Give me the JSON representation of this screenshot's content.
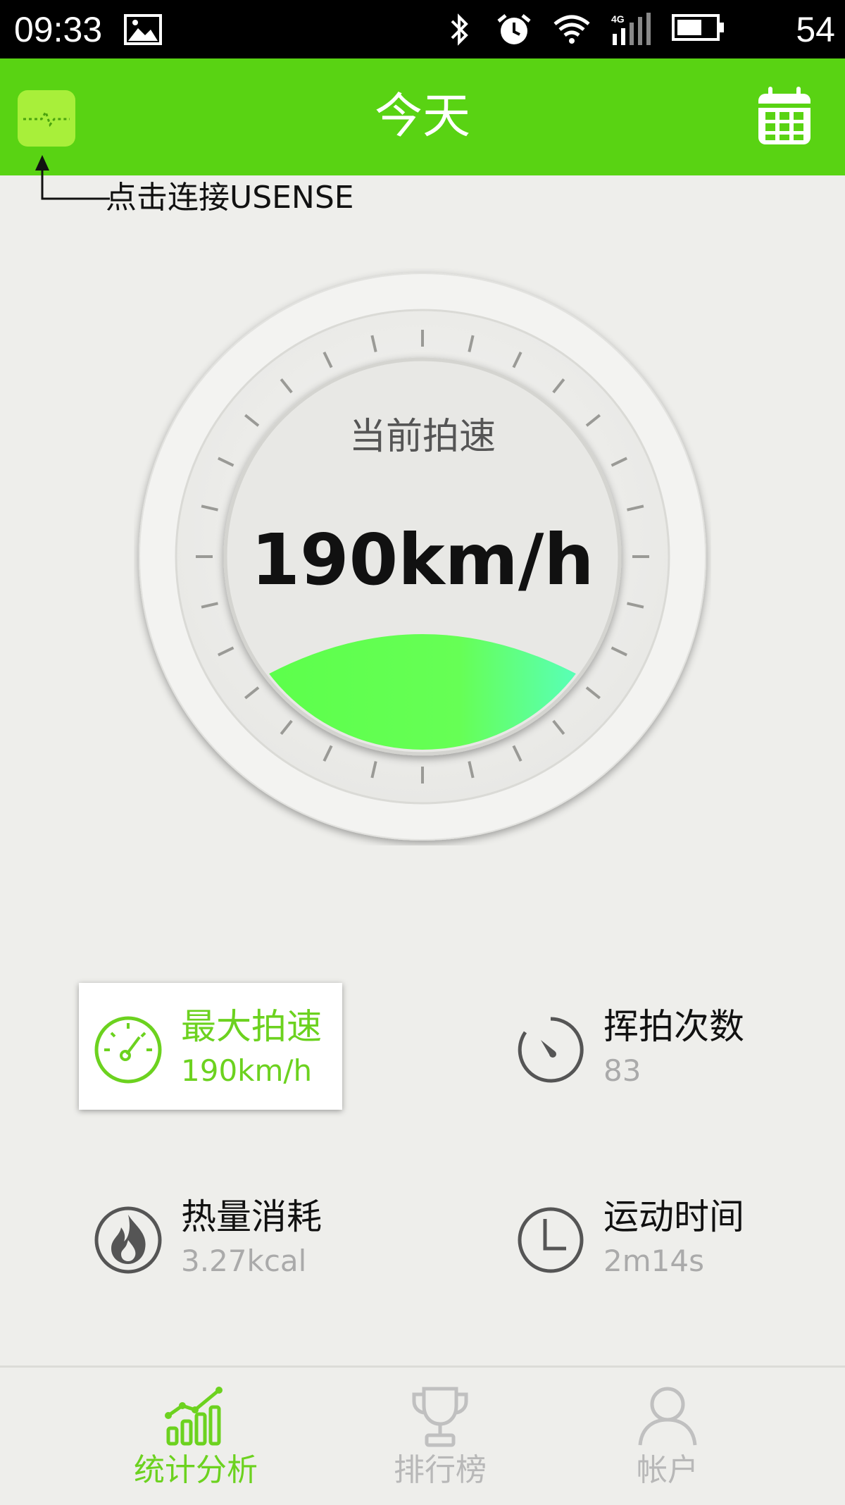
{
  "status_bar": {
    "time": "09:33",
    "battery": "54",
    "icons": [
      "image-icon",
      "bluetooth-icon",
      "alarm-icon",
      "wifi-icon",
      "signal-4g-icon",
      "battery-icon"
    ]
  },
  "header": {
    "title": "今天",
    "left_icon": "pulse-icon",
    "right_icon": "calendar-icon"
  },
  "hint": {
    "text": "点击连接USENSE"
  },
  "gauge": {
    "title": "当前拍速",
    "value": "190km/h"
  },
  "stats": [
    {
      "label": "最大拍速",
      "value": "190km/h",
      "icon": "speedometer-icon",
      "active": true
    },
    {
      "label": "挥拍次数",
      "value": "83",
      "icon": "timer-icon",
      "active": false
    },
    {
      "label": "热量消耗",
      "value": "3.27kcal",
      "icon": "flame-icon",
      "active": false
    },
    {
      "label": "运动时间",
      "value": "2m14s",
      "icon": "clock-icon",
      "active": false
    }
  ],
  "nav": [
    {
      "label": "统计分析",
      "icon": "chart-icon",
      "active": true
    },
    {
      "label": "排行榜",
      "icon": "trophy-icon",
      "active": false
    },
    {
      "label": "帐户",
      "icon": "user-icon",
      "active": false
    }
  ],
  "colors": {
    "accent": "#59d313",
    "accent_text": "#6cd21f",
    "inactive": "#b8b8b8"
  }
}
